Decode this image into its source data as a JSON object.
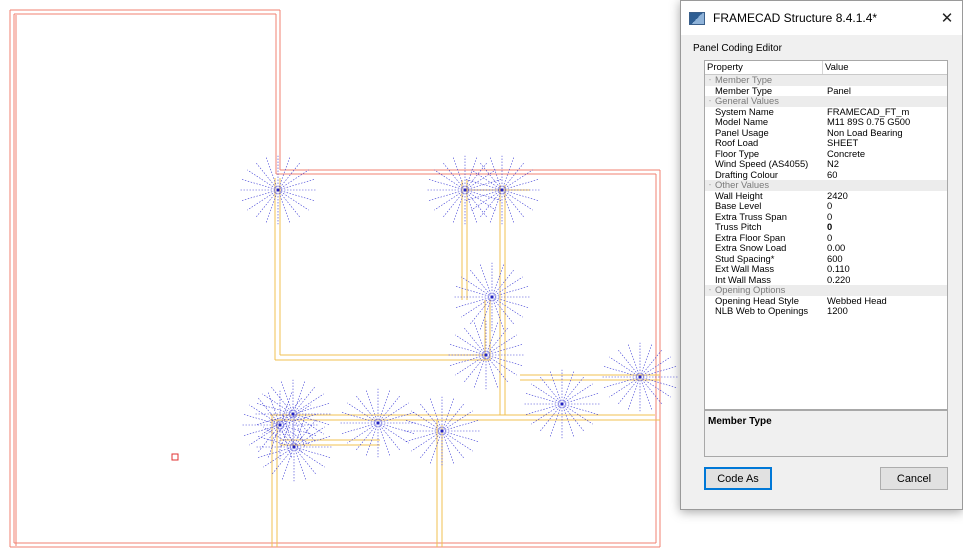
{
  "dialog": {
    "title": "FRAMECAD Structure 8.4.1.4*",
    "close_glyph": "✕",
    "app_icon": "framecad-app-icon",
    "group_label": "Panel Coding Editor",
    "columns": [
      "Property",
      "Value"
    ],
    "rows": [
      {
        "type": "category",
        "name": "Member Type"
      },
      {
        "type": "prop",
        "name": "Member Type",
        "value": "Panel"
      },
      {
        "type": "category",
        "name": "General Values"
      },
      {
        "type": "prop",
        "name": "System Name",
        "value": "FRAMECAD_FT_m"
      },
      {
        "type": "prop",
        "name": "Model Name",
        "value": "M11 89S 0.75 G500"
      },
      {
        "type": "prop",
        "name": "Panel Usage",
        "value": "Non Load Bearing"
      },
      {
        "type": "prop",
        "name": "Roof Load",
        "value": "SHEET"
      },
      {
        "type": "prop",
        "name": "Floor Type",
        "value": "Concrete"
      },
      {
        "type": "prop",
        "name": "Wind Speed (AS4055)",
        "value": "N2"
      },
      {
        "type": "prop",
        "name": "Drafting Colour",
        "value": "60"
      },
      {
        "type": "category",
        "name": "Other Values"
      },
      {
        "type": "prop",
        "name": "Wall Height",
        "value": "2420"
      },
      {
        "type": "prop",
        "name": "Base Level",
        "value": "0"
      },
      {
        "type": "prop",
        "name": "Extra Truss Span",
        "value": "0"
      },
      {
        "type": "prop",
        "name": "Truss Pitch",
        "value": "0",
        "bold": true
      },
      {
        "type": "prop",
        "name": "Extra Floor Span",
        "value": "0"
      },
      {
        "type": "prop",
        "name": "Extra Snow Load",
        "value": "0.00"
      },
      {
        "type": "prop",
        "name": "Stud Spacing*",
        "value": "600"
      },
      {
        "type": "prop",
        "name": "Ext Wall Mass",
        "value": "0.110"
      },
      {
        "type": "prop",
        "name": "Int Wall Mass",
        "value": "0.220"
      },
      {
        "type": "category",
        "name": "Opening Options"
      },
      {
        "type": "prop",
        "name": "Opening Head Style",
        "value": "Webbed Head"
      },
      {
        "type": "prop",
        "name": "NLB Web to Openings",
        "value": "1200"
      }
    ],
    "description_title": "Member Type",
    "code_as_label": "Code As",
    "cancel_label": "Cancel"
  },
  "colors": {
    "wall_outer": "#f08070",
    "wall_inner": "#f0c050",
    "node_rays": "#3b3bd6",
    "node_center": "#2020c0",
    "marker": "#e03030"
  }
}
